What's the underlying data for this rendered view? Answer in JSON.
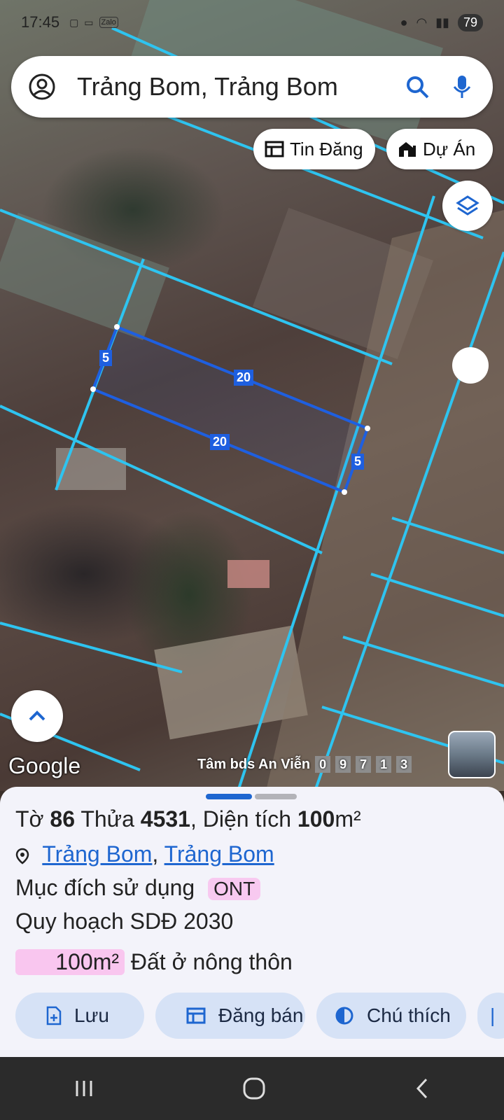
{
  "status_bar": {
    "time": "17:45",
    "battery": "79",
    "small_icons": [
      "screenshot-icon",
      "cast-icon",
      "zalo-icon"
    ],
    "zalo_label": "Zalo"
  },
  "search": {
    "text": "Trảng Bom, Trảng Bom",
    "icons": [
      "account-icon",
      "search-icon",
      "mic-icon"
    ]
  },
  "pills": {
    "listings": "Tin Đăng",
    "projects": "Dự Án"
  },
  "map": {
    "parcel_labels": [
      "5",
      "20",
      "20",
      "5"
    ],
    "attribution": "Google",
    "watermark_name": "Tâm bds An Viễn",
    "watermark_digits": [
      "0",
      "9",
      "7",
      "1",
      "3"
    ],
    "colors": {
      "cadastral_line": "#2ec4f0",
      "selected_parcel": "#1e5fe0"
    }
  },
  "sheet": {
    "to_label": "Tờ",
    "to_value": "86",
    "thua_label": "Thửa",
    "thua_value": "4531",
    "area_label": ", Diện tích",
    "area_value": "100",
    "area_unit": "m²",
    "location_a": "Trảng Bom",
    "location_sep": ",",
    "location_b": "Trảng Bom",
    "purpose_label": "Mục đích sử dụng",
    "purpose_code": "ONT",
    "planning_label": "Quy hoạch SDĐ 2030",
    "planning_area": "100m²",
    "planning_type": "Đất ở nông thôn"
  },
  "actions": {
    "save": "Lưu",
    "sell": "Đăng bán",
    "legend": "Chú thích"
  },
  "nav": {
    "icons": [
      "recent-apps-icon",
      "home-icon",
      "back-icon"
    ]
  }
}
